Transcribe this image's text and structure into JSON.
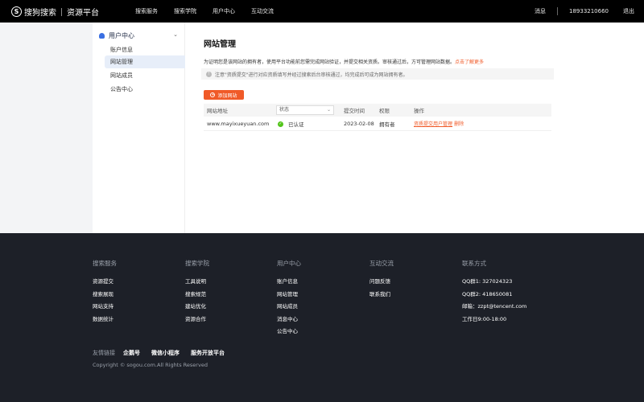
{
  "topbar": {
    "logo_mark": "S",
    "brand": "搜狗搜索",
    "product": "资源平台",
    "nav": [
      "搜索服务",
      "搜索学院",
      "用户中心",
      "互动交流"
    ],
    "message": "消息",
    "phone": "18933210660",
    "logout": "退出"
  },
  "sidebar": {
    "header": "用户中心",
    "items": [
      {
        "label": "账户信息",
        "active": false
      },
      {
        "label": "网站管理",
        "active": true
      },
      {
        "label": "网站成员",
        "active": false
      },
      {
        "label": "公告中心",
        "active": false
      }
    ]
  },
  "main": {
    "title": "网站管理",
    "intro_text": "为证明您是该网站的拥有者，使用平台功能前您需完成网站验证，并提交相关资质。审核通过后，方可管理网站数据。",
    "intro_link": "点击了解更多",
    "notice": "注意\"资质提交\"进行对应资质填写并经过搜索后台审核通过，均完成后可成为网站拥有者。",
    "add_button": "添加网站",
    "table": {
      "headers": [
        "网站地址",
        "状态",
        "提交时间",
        "权限",
        "操作"
      ],
      "status_filter": "状态",
      "rows": [
        {
          "url": "www.mayixueyuan.com",
          "status": "已认证",
          "date": "2023-02-08",
          "role": "拥有者",
          "ops": [
            "资质提交",
            "用户管理",
            "删除"
          ]
        }
      ]
    }
  },
  "footer": {
    "columns": [
      {
        "title": "搜索服务",
        "items": [
          "资源提交",
          "搜索展现",
          "网站支持",
          "数据统计"
        ]
      },
      {
        "title": "搜索学院",
        "items": [
          "工具说明",
          "搜索规范",
          "建站优化",
          "资源合作"
        ]
      },
      {
        "title": "用户中心",
        "items": [
          "账户信息",
          "网站管理",
          "网站成员",
          "消息中心",
          "公告中心"
        ]
      },
      {
        "title": "互动交流",
        "items": [
          "问题反馈",
          "联系我们"
        ]
      },
      {
        "title": "联系方式",
        "items": [
          "QQ群1: 327024323",
          "QQ群2: 418650081",
          "邮箱：zzpt@tencent.com",
          "工作日9:00-18:00"
        ]
      }
    ],
    "friend_label": "友情链接",
    "friend_links": [
      "企鹅号",
      "微信小程序",
      "服务开放平台"
    ],
    "copyright": "Copyright © sogou.com.All Rights Reserved"
  },
  "colors": {
    "accent": "#f05a28",
    "topbar_bg": "#000000",
    "footer_bg": "#1d2028",
    "active_bg": "#e7eef9",
    "success": "#52c41a"
  }
}
